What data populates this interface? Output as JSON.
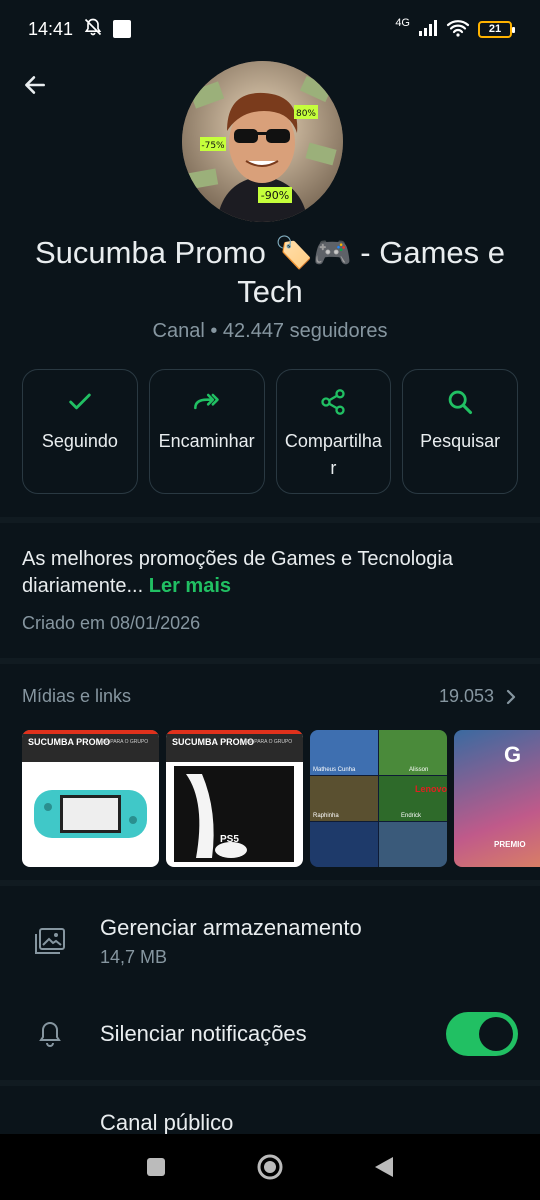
{
  "status_bar": {
    "time": "14:41",
    "network": "4G",
    "battery": "21"
  },
  "channel": {
    "title": "Sucumba Promo 🏷️🎮  - Games e Tech",
    "subtitle": "Canal • 42.447 seguidores",
    "avatar_badges": [
      "80%",
      "-75%",
      "-90%"
    ]
  },
  "actions": [
    {
      "label": "Seguindo",
      "icon": "check-icon"
    },
    {
      "label": "Encaminhar",
      "icon": "forward-icon"
    },
    {
      "label": "Compartilhar",
      "icon": "share-icon"
    },
    {
      "label": "Pesquisar",
      "icon": "search-icon"
    }
  ],
  "description": {
    "text": "As melhores promoções de Games e Tecnologia diariamente...",
    "read_more": "Ler mais",
    "created": "Criado em 08/01/2026"
  },
  "media": {
    "title": "Mídias e links",
    "count": "19.053",
    "thumbs": [
      {
        "header": "SUCUMBA PROMO",
        "tagline": "VEM PARA O GRUPO",
        "label": ""
      },
      {
        "header": "SUCUMBA PROMO",
        "tagline": "VEM PARA O GRUPO",
        "label": "PS5"
      },
      {
        "names": [
          "Matheus Cunha",
          "Alisson",
          "Raphinha",
          "Endrick",
          "Lenovo"
        ]
      },
      {
        "label": "PREMIO"
      }
    ]
  },
  "settings": {
    "storage": {
      "title": "Gerenciar armazenamento",
      "sub": "14,7 MB"
    },
    "mute": {
      "title": "Silenciar notificações",
      "enabled": true
    },
    "public": {
      "title": "Canal público"
    }
  },
  "colors": {
    "accent": "#21c063",
    "background": "#0b141a",
    "muted_text": "#8696a0"
  }
}
